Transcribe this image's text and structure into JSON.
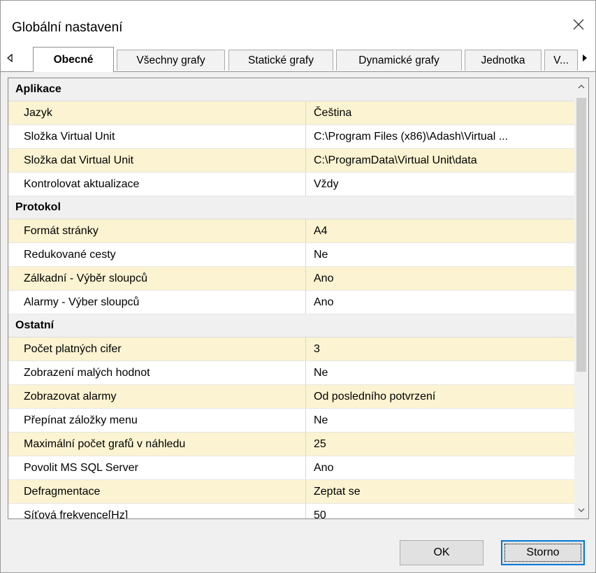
{
  "window": {
    "title": "Globální nastavení"
  },
  "tabs": [
    {
      "label": "Obecné",
      "active": true
    },
    {
      "label": "Všechny grafy",
      "active": false
    },
    {
      "label": "Statické grafy",
      "active": false
    },
    {
      "label": "Dynamické grafy",
      "active": false
    },
    {
      "label": "Jednotka",
      "active": false
    },
    {
      "label": "V...",
      "active": false
    }
  ],
  "grid": {
    "aplikace": {
      "category": "Aplikace",
      "rows": [
        {
          "name": "Jazyk",
          "value": "Čeština"
        },
        {
          "name": "Složka Virtual Unit",
          "value": "C:\\Program Files (x86)\\Adash\\Virtual ..."
        },
        {
          "name": "Složka dat Virtual Unit",
          "value": "C:\\ProgramData\\Virtual Unit\\data"
        },
        {
          "name": "Kontrolovat aktualizace",
          "value": "Vždy"
        }
      ]
    },
    "protokol": {
      "category": "Protokol",
      "rows": [
        {
          "name": "Formát stránky",
          "value": "A4"
        },
        {
          "name": "Redukované cesty",
          "value": "Ne"
        },
        {
          "name": "Zálkadní - Výběr sloupců",
          "value": "Ano"
        },
        {
          "name": "Alarmy - Výber sloupců",
          "value": "Ano"
        }
      ]
    },
    "ostatni": {
      "category": "Ostatní",
      "rows": [
        {
          "name": "Počet platných cifer",
          "value": "3"
        },
        {
          "name": "Zobrazení malých hodnot",
          "value": "Ne"
        },
        {
          "name": "Zobrazovat alarmy",
          "value": "Od posledního potvrzení"
        },
        {
          "name": "Přepínat záložky menu",
          "value": "Ne"
        },
        {
          "name": "Maximální počet grafů v náhledu",
          "value": "25"
        },
        {
          "name": "Povolit MS SQL Server",
          "value": "Ano"
        },
        {
          "name": "Defragmentace",
          "value": "Zeptat se"
        },
        {
          "name": "Síťová frekvence[Hz]",
          "value": "50"
        }
      ]
    }
  },
  "buttons": {
    "ok": "OK",
    "cancel": "Storno"
  },
  "colors": {
    "row_highlight": "#fbf3d1",
    "focus_border": "#0078d7"
  },
  "icons": {
    "close": "close-icon",
    "tab_scroll_left": "triangle-left-icon",
    "tab_scroll_right": "triangle-right-icon",
    "scroll_up": "chevron-up-icon",
    "scroll_down": "chevron-down-icon"
  }
}
